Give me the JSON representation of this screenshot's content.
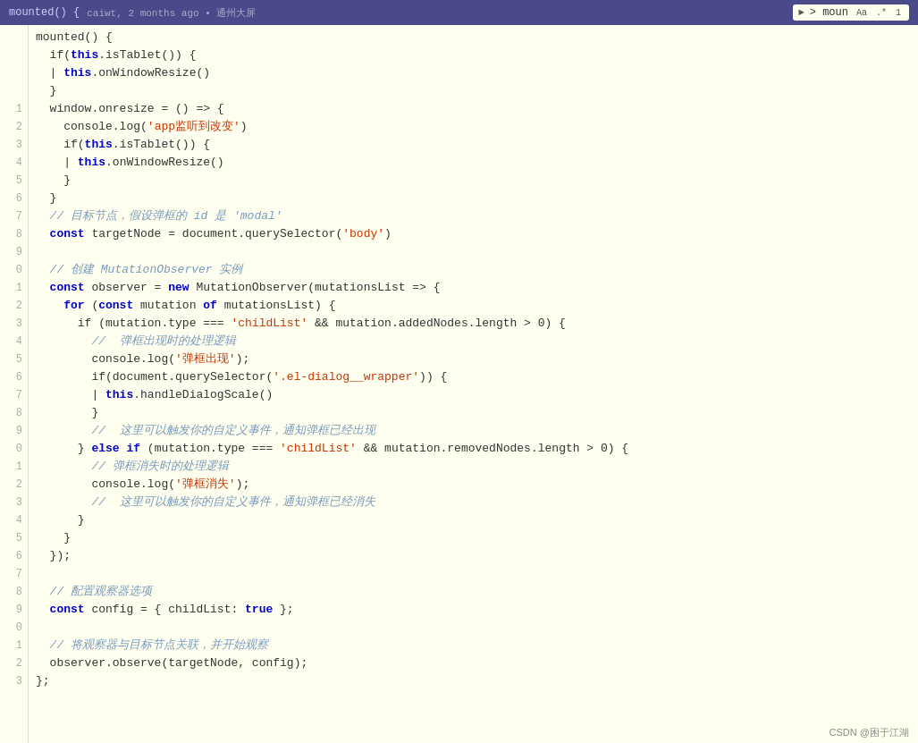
{
  "topbar": {
    "title": "mounted() {",
    "meta": "caiwt, 2 months ago • 通州大屏",
    "search_placeholder": "moun",
    "search_label": "> moun",
    "btn_aa": "Aa",
    "btn_regex": ".*",
    "btn_case": "1"
  },
  "footer": {
    "text": "CSDN @困于江湖"
  },
  "lines": [
    {
      "num": "",
      "content": "mounted() {",
      "tokens": [
        {
          "t": "plain",
          "v": "mounted() {"
        }
      ]
    },
    {
      "num": "",
      "content": "  if(this.isTablet()) {",
      "tokens": [
        {
          "t": "plain",
          "v": "  if("
        },
        {
          "t": "kw",
          "v": "this"
        },
        {
          "t": "plain",
          "v": ".isTablet()) {"
        }
      ]
    },
    {
      "num": "",
      "content": "  | this.onWindowResize()",
      "tokens": [
        {
          "t": "plain",
          "v": "  | "
        },
        {
          "t": "kw",
          "v": "this"
        },
        {
          "t": "plain",
          "v": ".onWindowResize()"
        }
      ]
    },
    {
      "num": "",
      "content": "  }",
      "tokens": [
        {
          "t": "plain",
          "v": "  }"
        }
      ]
    },
    {
      "num": "1",
      "content": "  window.onresize = () => {",
      "tokens": [
        {
          "t": "plain",
          "v": "  window.onresize = () => {"
        }
      ]
    },
    {
      "num": "2",
      "content": "    console.log('app监听到改变')",
      "tokens": [
        {
          "t": "plain",
          "v": "    console.log("
        },
        {
          "t": "str",
          "v": "'app监听到改变'"
        },
        {
          "t": "plain",
          "v": ")"
        }
      ]
    },
    {
      "num": "3",
      "content": "    if(this.isTablet()) {",
      "tokens": [
        {
          "t": "plain",
          "v": "    if("
        },
        {
          "t": "kw",
          "v": "this"
        },
        {
          "t": "plain",
          "v": ".isTablet()) {"
        }
      ]
    },
    {
      "num": "4",
      "content": "    | this.onWindowResize()",
      "tokens": [
        {
          "t": "plain",
          "v": "    | "
        },
        {
          "t": "kw",
          "v": "this"
        },
        {
          "t": "plain",
          "v": ".onWindowResize()"
        }
      ]
    },
    {
      "num": "5",
      "content": "    }",
      "tokens": [
        {
          "t": "plain",
          "v": "    }"
        }
      ]
    },
    {
      "num": "6",
      "content": "  }",
      "tokens": [
        {
          "t": "plain",
          "v": "  }"
        }
      ]
    },
    {
      "num": "7",
      "content": "  // 目标节点，假设弹框的 id 是 'modal'",
      "tokens": [
        {
          "t": "cmt",
          "v": "  // 目标节点，假设弹框的 id 是 'modal'"
        }
      ]
    },
    {
      "num": "8",
      "content": "  const targetNode = document.querySelector('body')",
      "tokens": [
        {
          "t": "kw",
          "v": "  const"
        },
        {
          "t": "plain",
          "v": " targetNode = document.querySelector("
        },
        {
          "t": "str",
          "v": "'body'"
        },
        {
          "t": "plain",
          "v": ")"
        }
      ]
    },
    {
      "num": "9",
      "content": "",
      "tokens": []
    },
    {
      "num": "0",
      "content": "  // 创建 MutationObserver 实例",
      "tokens": [
        {
          "t": "cmt",
          "v": "  // 创建 MutationObserver 实例"
        }
      ]
    },
    {
      "num": "1",
      "content": "  const observer = new MutationObserver(mutationsList => {",
      "tokens": [
        {
          "t": "kw",
          "v": "  const"
        },
        {
          "t": "plain",
          "v": " observer = "
        },
        {
          "t": "kw",
          "v": "new"
        },
        {
          "t": "plain",
          "v": " MutationObserver(mutationsList => {"
        }
      ]
    },
    {
      "num": "2",
      "content": "    for (const mutation of mutationsList) {",
      "tokens": [
        {
          "t": "kw",
          "v": "    for"
        },
        {
          "t": "plain",
          "v": " ("
        },
        {
          "t": "kw",
          "v": "const"
        },
        {
          "t": "plain",
          "v": " mutation "
        },
        {
          "t": "kw",
          "v": "of"
        },
        {
          "t": "plain",
          "v": " mutationsList) {"
        }
      ]
    },
    {
      "num": "3",
      "content": "      if (mutation.type === 'childList' && mutation.addedNodes.length > 0) {",
      "tokens": [
        {
          "t": "plain",
          "v": "      if (mutation.type === "
        },
        {
          "t": "str",
          "v": "'childList'"
        },
        {
          "t": "plain",
          "v": " && mutation.addedNodes.length > 0) {"
        }
      ]
    },
    {
      "num": "4",
      "content": "        //  弹框出现时的处理逻辑",
      "tokens": [
        {
          "t": "cmt",
          "v": "        //  弹框出现时的处理逻辑"
        }
      ]
    },
    {
      "num": "5",
      "content": "        console.log('弹框出现');",
      "tokens": [
        {
          "t": "plain",
          "v": "        console.log("
        },
        {
          "t": "str",
          "v": "'弹框出现'"
        },
        {
          "t": "plain",
          "v": ");"
        }
      ]
    },
    {
      "num": "6",
      "content": "        if(document.querySelector('.el-dialog__wrapper')) {",
      "tokens": [
        {
          "t": "plain",
          "v": "        if(document.querySelector("
        },
        {
          "t": "str",
          "v": "'.el-dialog__wrapper'"
        },
        {
          "t": "plain",
          "v": ")) {"
        }
      ]
    },
    {
      "num": "7",
      "content": "        | this.handleDialogScale()",
      "tokens": [
        {
          "t": "plain",
          "v": "        | "
        },
        {
          "t": "kw",
          "v": "this"
        },
        {
          "t": "plain",
          "v": ".handleDialogScale()"
        }
      ]
    },
    {
      "num": "8",
      "content": "        }",
      "tokens": [
        {
          "t": "plain",
          "v": "        }"
        }
      ]
    },
    {
      "num": "9",
      "content": "        //  这里可以触发你的自定义事件，通知弹框已经出现",
      "tokens": [
        {
          "t": "cmt",
          "v": "        //  这里可以触发你的自定义事件，通知弹框已经出现"
        }
      ]
    },
    {
      "num": "0",
      "content": "      } else if (mutation.type === 'childList' && mutation.removedNodes.length > 0) {",
      "tokens": [
        {
          "t": "plain",
          "v": "      } "
        },
        {
          "t": "kw",
          "v": "else if"
        },
        {
          "t": "plain",
          "v": " (mutation.type === "
        },
        {
          "t": "str",
          "v": "'childList'"
        },
        {
          "t": "plain",
          "v": " && mutation.removedNodes.length > 0) {"
        }
      ]
    },
    {
      "num": "1",
      "content": "        // 弹框消失时的处理逻辑",
      "tokens": [
        {
          "t": "cmt",
          "v": "        // 弹框消失时的处理逻辑"
        }
      ]
    },
    {
      "num": "2",
      "content": "        console.log('弹框消失');",
      "tokens": [
        {
          "t": "plain",
          "v": "        console.log("
        },
        {
          "t": "str",
          "v": "'弹框消失'"
        },
        {
          "t": "plain",
          "v": ");"
        }
      ]
    },
    {
      "num": "3",
      "content": "        //  这里可以触发你的自定义事件，通知弹框已经消失",
      "tokens": [
        {
          "t": "cmt",
          "v": "        //  这里可以触发你的自定义事件，通知弹框已经消失"
        }
      ]
    },
    {
      "num": "4",
      "content": "      }",
      "tokens": [
        {
          "t": "plain",
          "v": "      }"
        }
      ]
    },
    {
      "num": "5",
      "content": "    }",
      "tokens": [
        {
          "t": "plain",
          "v": "    }"
        }
      ]
    },
    {
      "num": "6",
      "content": "  });",
      "tokens": [
        {
          "t": "plain",
          "v": "  });"
        }
      ]
    },
    {
      "num": "7",
      "content": "",
      "tokens": []
    },
    {
      "num": "8",
      "content": "  // 配置观察器选项",
      "tokens": [
        {
          "t": "cmt",
          "v": "  // 配置观察器选项"
        }
      ]
    },
    {
      "num": "9",
      "content": "  const config = { childList: true };",
      "tokens": [
        {
          "t": "kw",
          "v": "  const"
        },
        {
          "t": "plain",
          "v": " config = { childList: "
        },
        {
          "t": "kw",
          "v": "true"
        },
        {
          "t": "plain",
          "v": " };"
        }
      ]
    },
    {
      "num": "0",
      "content": "",
      "tokens": []
    },
    {
      "num": "1",
      "content": "  // 将观察器与目标节点关联，并开始观察",
      "tokens": [
        {
          "t": "cmt",
          "v": "  // 将观察器与目标节点关联，并开始观察"
        }
      ]
    },
    {
      "num": "2",
      "content": "  observer.observe(targetNode, config);",
      "tokens": [
        {
          "t": "plain",
          "v": "  observer.observe(targetNode, config);"
        }
      ]
    },
    {
      "num": "3",
      "content": "};",
      "tokens": [
        {
          "t": "plain",
          "v": "};"
        }
      ]
    }
  ]
}
